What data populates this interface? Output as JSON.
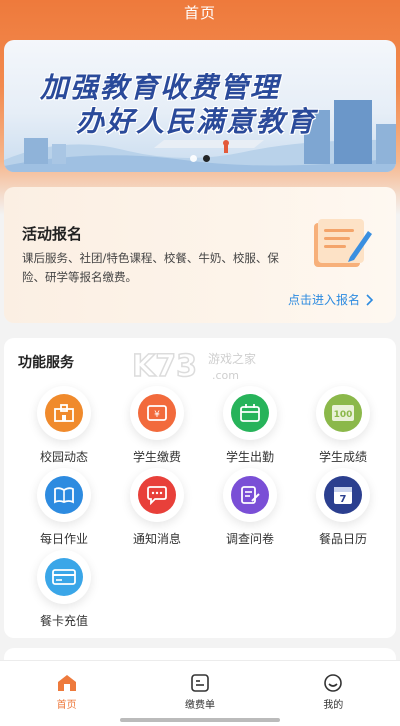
{
  "header": {
    "title": "首页"
  },
  "banner": {
    "line1": "加强教育收费管理",
    "line2": "办好人民满意教育",
    "active_slide": 2,
    "slide_count": 2
  },
  "activity": {
    "title": "活动报名",
    "description": "课后服务、社团/特色课程、校餐、牛奶、校服、保险、研学等报名缴费。",
    "link_label": "点击进入报名",
    "link_icon": "chevron-right-icon"
  },
  "services": {
    "title": "功能服务",
    "watermark": "K73 游戏之家 .com",
    "items": [
      {
        "label": "校园动态",
        "icon": "school-building-icon",
        "color": "#f08a2c"
      },
      {
        "label": "学生缴费",
        "icon": "payment-wallet-icon",
        "color": "#f26a3c"
      },
      {
        "label": "学生出勤",
        "icon": "attendance-calendar-icon",
        "color": "#27b35a"
      },
      {
        "label": "学生成绩",
        "icon": "score-100-icon",
        "color": "#8bb84a"
      },
      {
        "label": "每日作业",
        "icon": "book-icon",
        "color": "#2d8be0"
      },
      {
        "label": "通知消息",
        "icon": "message-bubble-icon",
        "color": "#e8403a"
      },
      {
        "label": "调查问卷",
        "icon": "survey-edit-icon",
        "color": "#7a4fd6"
      },
      {
        "label": "餐品日历",
        "icon": "calendar-7-icon",
        "color": "#2b3f8f"
      },
      {
        "label": "餐卡充值",
        "icon": "meal-card-icon",
        "color": "#3aa6e8"
      }
    ]
  },
  "tabbar": {
    "tabs": [
      {
        "label": "首页",
        "icon": "home-icon",
        "active": true
      },
      {
        "label": "缴费单",
        "icon": "bill-icon",
        "active": false
      },
      {
        "label": "我的",
        "icon": "smile-face-icon",
        "active": false
      }
    ],
    "accent": "#ee7a3c"
  }
}
